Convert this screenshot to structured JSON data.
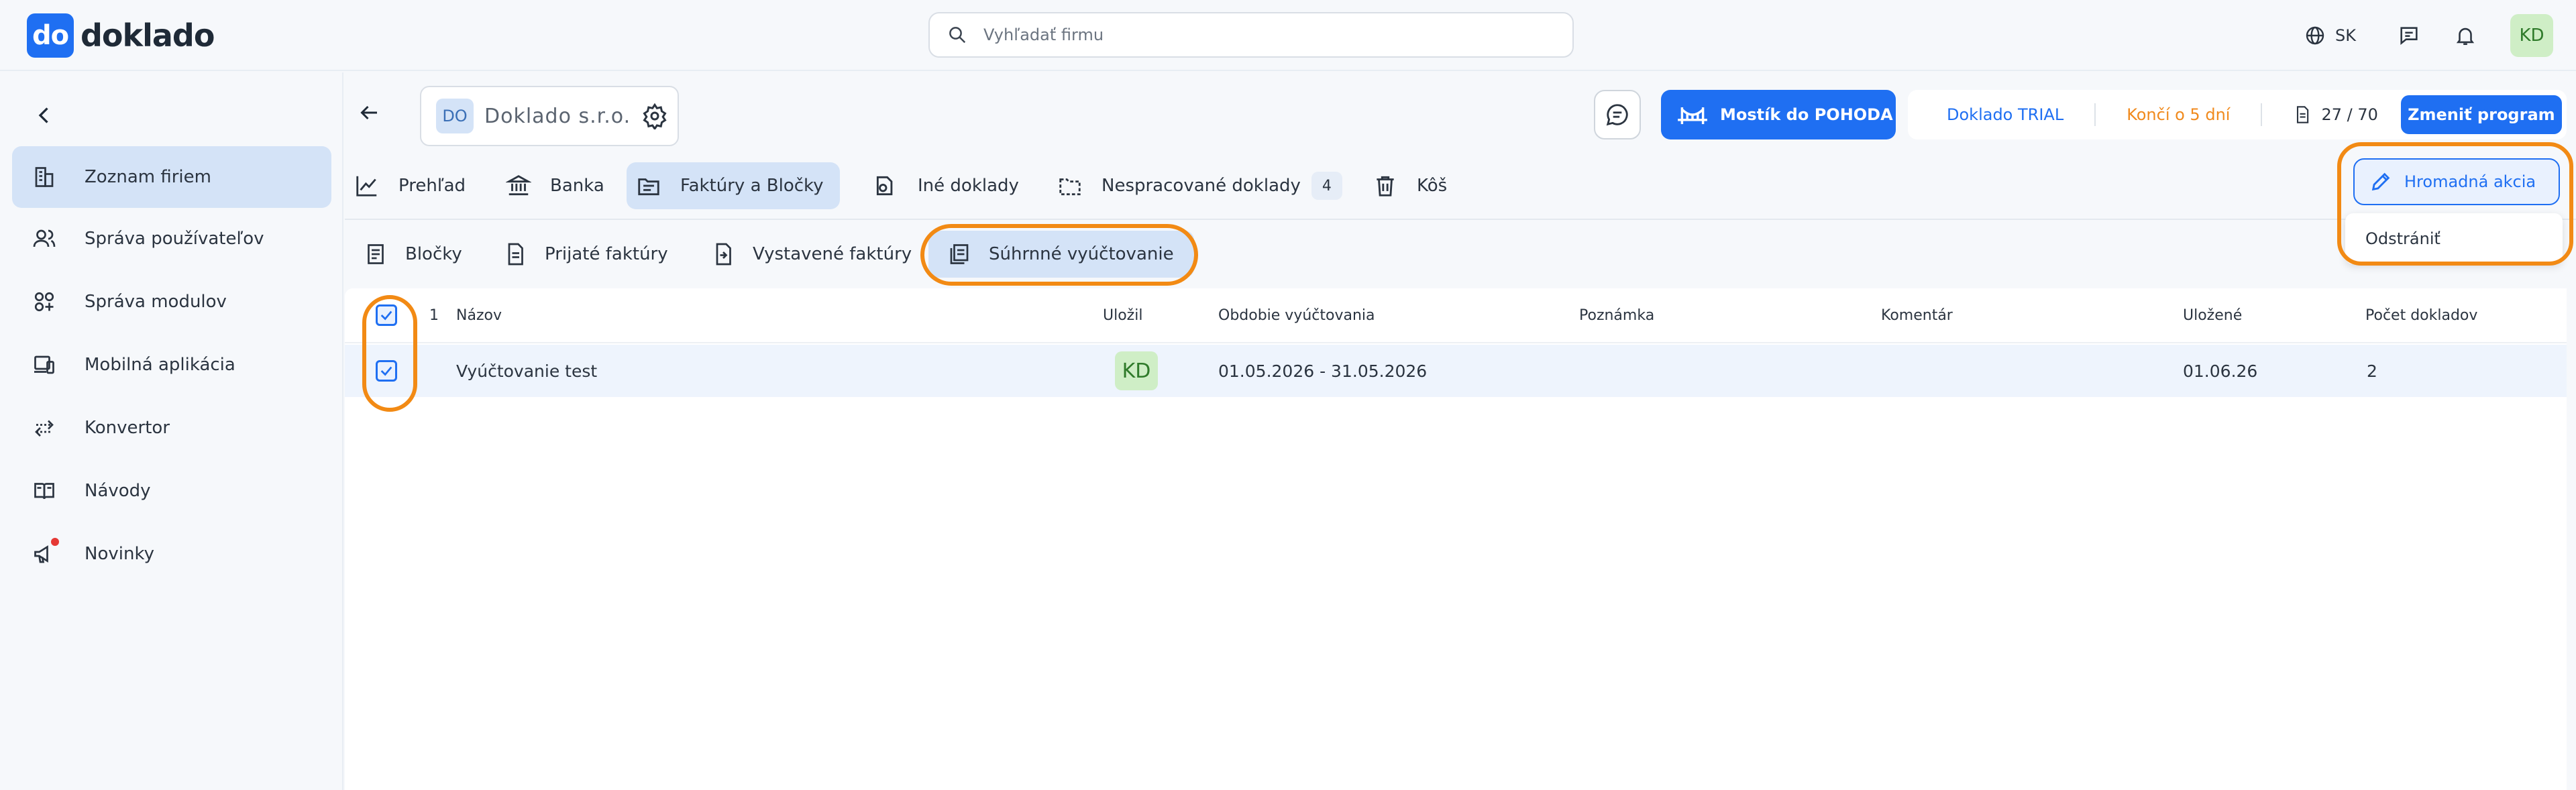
{
  "header": {
    "logo_mark": "do",
    "logo_text": "doklado",
    "search_placeholder": "Vyhľadať firmu",
    "language": "SK",
    "user_initials": "KD"
  },
  "sidebar": {
    "items": [
      {
        "label": "Zoznam firiem",
        "icon": "building-icon"
      },
      {
        "label": "Správa používateľov",
        "icon": "users-icon"
      },
      {
        "label": "Správa modulov",
        "icon": "modules-icon"
      },
      {
        "label": "Mobilná aplikácia",
        "icon": "devices-icon"
      },
      {
        "label": "Konvertor",
        "icon": "convert-icon"
      },
      {
        "label": "Návody",
        "icon": "book-icon"
      },
      {
        "label": "Novinky",
        "icon": "megaphone-icon"
      }
    ]
  },
  "company": {
    "badge": "DO",
    "name": "Doklado s.r.o."
  },
  "actions": {
    "pohoda_label": "Mostík do POHODA",
    "plan_name": "Doklado TRIAL",
    "plan_ends": "Končí o 5 dní",
    "doc_count": "27 / 70",
    "change_plan_label": "Zmeniť program"
  },
  "tabs_main": [
    {
      "label": "Prehľad",
      "icon": "chart-icon"
    },
    {
      "label": "Banka",
      "icon": "bank-icon"
    },
    {
      "label": "Faktúry a Bločky",
      "icon": "invoice-icon"
    },
    {
      "label": "Iné doklady",
      "icon": "documents-icon"
    },
    {
      "label": "Nespracované doklady",
      "icon": "folder-icon",
      "count": "4"
    },
    {
      "label": "Kôš",
      "icon": "trash-icon"
    }
  ],
  "bulk": {
    "label": "Hromadná akcia",
    "menu_item": "Odstrániť"
  },
  "tabs_sub": [
    {
      "label": "Bločky",
      "icon": "receipt-icon"
    },
    {
      "label": "Prijaté faktúry",
      "icon": "doc-icon"
    },
    {
      "label": "Vystavené faktúry",
      "icon": "export-icon"
    },
    {
      "label": "Súhrnné vyúčtovanie",
      "icon": "summary-icon"
    }
  ],
  "table": {
    "selected_count": "1",
    "columns": [
      "Názov",
      "Uložil",
      "Obdobie vyúčtovania",
      "Poznámka",
      "Komentár",
      "Uložené",
      "Počet dokladov"
    ],
    "rows": [
      {
        "name": "Vyúčtovanie test",
        "saved_by": "KD",
        "period": "01.05.2026 - 31.05.2026",
        "note": "",
        "comment": "",
        "saved": "01.06.26",
        "count": "2"
      }
    ]
  },
  "colors": {
    "accent": "#1f6ff2",
    "highlight": "#f28a14",
    "warning": "#f08a1d",
    "active_bg": "#d4e3f7"
  }
}
